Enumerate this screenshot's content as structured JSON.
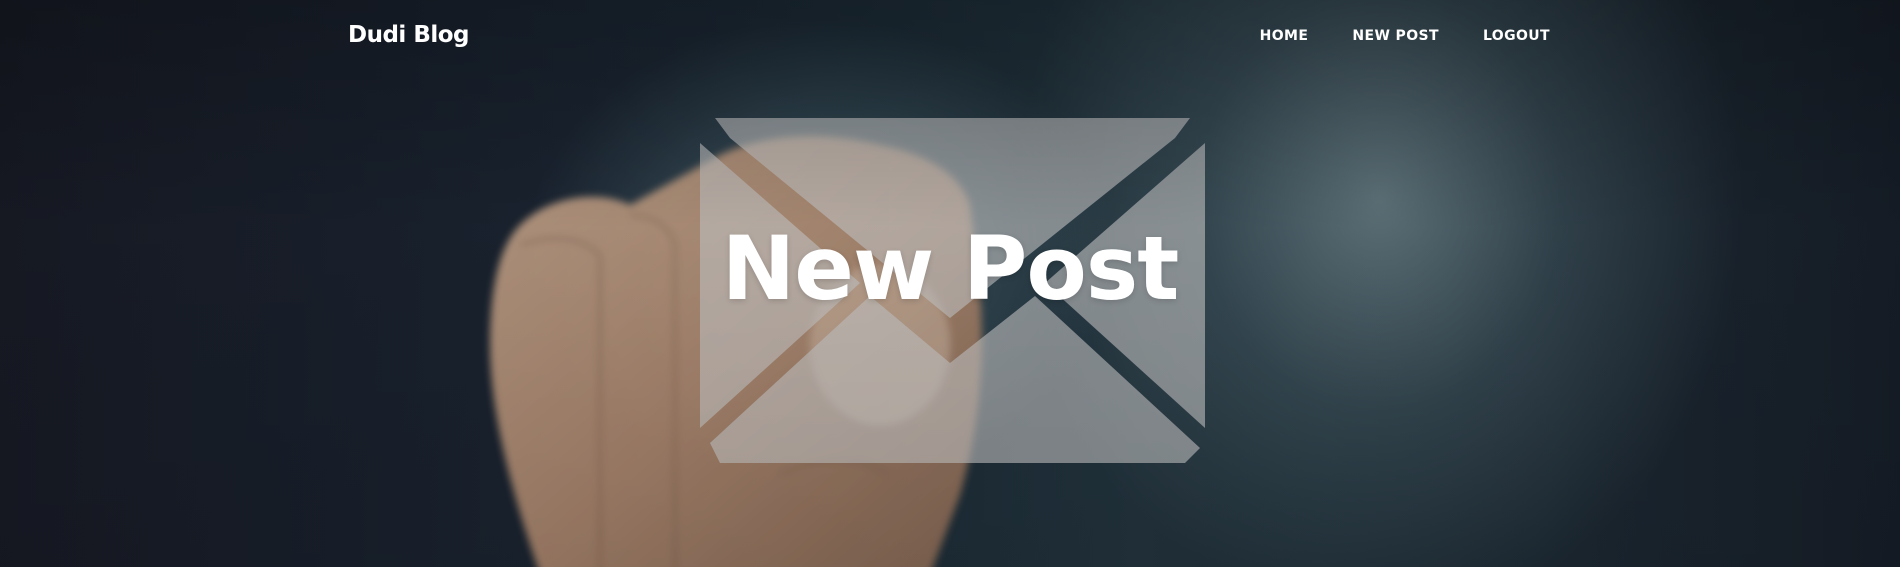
{
  "navbar": {
    "brand": "Dudi Blog",
    "items": [
      {
        "label": "HOME"
      },
      {
        "label": "NEW POST"
      },
      {
        "label": "LOGOUT"
      }
    ]
  },
  "header": {
    "title": "New Post"
  },
  "background": {
    "icon": "envelope-icon",
    "colors": {
      "dark": "#171a24",
      "mid": "#22333d",
      "text": "#ffffff"
    }
  }
}
